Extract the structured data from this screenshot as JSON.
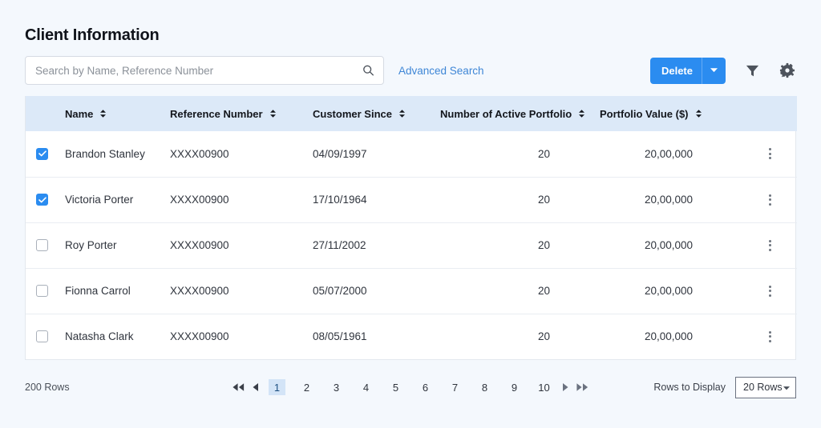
{
  "page": {
    "title": "Client Information"
  },
  "toolbar": {
    "search_placeholder": "Search by Name, Reference Number",
    "search_value": "",
    "search_icon": "search-icon",
    "advanced_search_label": "Advanced Search",
    "delete_label": "Delete",
    "delete_caret_icon": "chevron-down-icon",
    "filter_icon": "filter-funnel-icon",
    "settings_icon": "gear-icon",
    "accent_color": "#2b8cf0"
  },
  "table": {
    "header_bg": "#dce9f8",
    "columns": [
      {
        "label": "Name",
        "sortable": true
      },
      {
        "label": "Reference Number",
        "sortable": true
      },
      {
        "label": "Customer Since",
        "sortable": true
      },
      {
        "label": "Number of Active Portfolio",
        "sortable": true
      },
      {
        "label": "Portfolio Value ($)",
        "sortable": true
      }
    ],
    "rows": [
      {
        "selected": true,
        "name": "Brandon Stanley",
        "reference": "XXXX00900",
        "since": "04/09/1997",
        "active_portfolio": "20",
        "portfolio_value": "20,00,000"
      },
      {
        "selected": true,
        "name": "Victoria Porter",
        "reference": "XXXX00900",
        "since": "17/10/1964",
        "active_portfolio": "20",
        "portfolio_value": "20,00,000"
      },
      {
        "selected": false,
        "name": "Roy Porter",
        "reference": "XXXX00900",
        "since": "27/11/2002",
        "active_portfolio": "20",
        "portfolio_value": "20,00,000"
      },
      {
        "selected": false,
        "name": "Fionna Carrol",
        "reference": "XXXX00900",
        "since": "05/07/2000",
        "active_portfolio": "20",
        "portfolio_value": "20,00,000"
      },
      {
        "selected": false,
        "name": "Natasha Clark",
        "reference": "XXXX00900",
        "since": "08/05/1961",
        "active_portfolio": "20",
        "portfolio_value": "20,00,000"
      }
    ]
  },
  "footer": {
    "rows_total_label": "200 Rows",
    "pages": [
      "1",
      "2",
      "3",
      "4",
      "5",
      "6",
      "7",
      "8",
      "9",
      "10"
    ],
    "active_page": "1",
    "first_icon": "double-chevron-left-icon",
    "prev_icon": "chevron-left-icon",
    "next_icon": "chevron-right-icon",
    "last_icon": "double-chevron-right-icon",
    "rows_to_display_label": "Rows to Display",
    "rows_to_display_value": "20 Rows",
    "rows_to_display_caret": "chevron-down-icon"
  }
}
